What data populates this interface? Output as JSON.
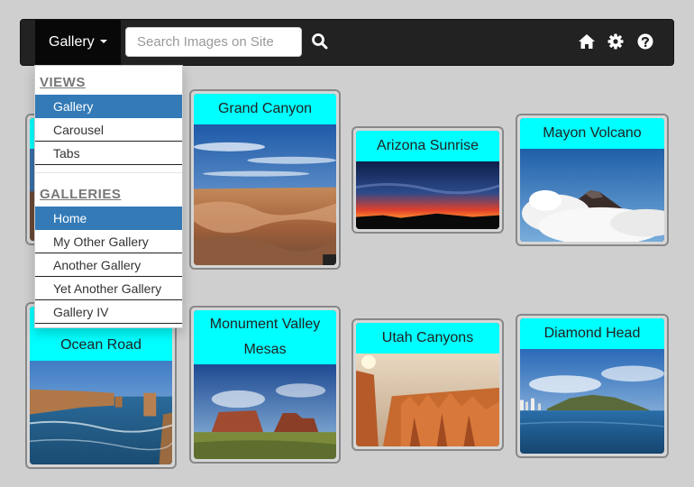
{
  "navbar": {
    "gallery_label": "Gallery",
    "search_placeholder": "Search Images on Site",
    "icons": [
      "search-icon",
      "home-icon",
      "gear-icon",
      "help-icon"
    ]
  },
  "dropdown": {
    "views_header": "VIEWS",
    "views": [
      "Gallery",
      "Carousel",
      "Tabs"
    ],
    "galleries_header": "GALLERIES",
    "galleries": [
      "Home",
      "My Other Gallery",
      "Another Gallery",
      "Yet Another Gallery",
      "Gallery IV"
    ],
    "active_view": "Gallery",
    "active_gallery": "Home"
  },
  "gallery": {
    "items": [
      {
        "title": ""
      },
      {
        "title": "Grand Canyon"
      },
      {
        "title": "Arizona Sunrise"
      },
      {
        "title": "Mayon Volcano"
      },
      {
        "title": "Ocean Road"
      },
      {
        "title": "Monument Valley Mesas"
      },
      {
        "title": "Utah Canyons"
      },
      {
        "title": "Diamond Head"
      }
    ]
  },
  "colors": {
    "navbar": "#222222",
    "title_bg": "#00ffff",
    "active_item": "#337ab7",
    "page_bg": "#cfcfcf"
  }
}
